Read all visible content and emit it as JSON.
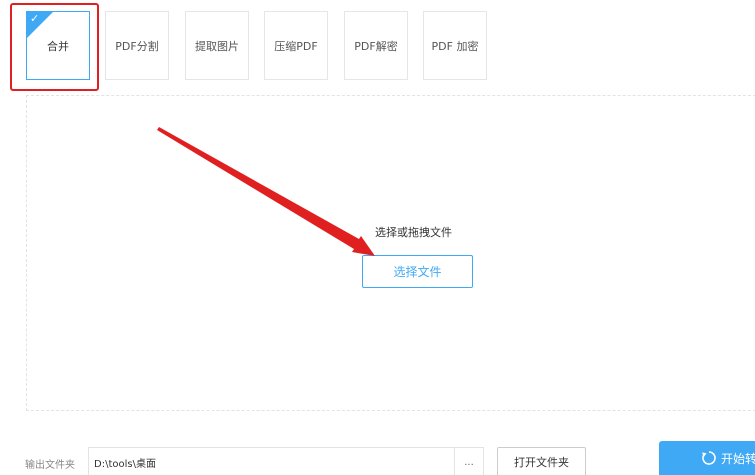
{
  "tool_tabs": [
    {
      "label": "合并",
      "active": true
    },
    {
      "label": "PDF分割",
      "active": false
    },
    {
      "label": "提取图片",
      "active": false
    },
    {
      "label": "压缩PDF",
      "active": false
    },
    {
      "label": "PDF解密",
      "active": false
    },
    {
      "label": "PDF 加密",
      "active": false
    }
  ],
  "drop_zone": {
    "hint": "选择或拖拽文件",
    "select_button": "选择文件"
  },
  "output": {
    "label": "输出文件夹",
    "path": "D:\\tools\\桌面",
    "browse": "...",
    "open_folder_button": "打开文件夹"
  },
  "start_button": {
    "label": "开始转"
  },
  "icons": {
    "active_check": "checkmark-icon",
    "start": "refresh-icon"
  },
  "colors": {
    "accent": "#3fa9f5",
    "highlight": "#e02020"
  }
}
